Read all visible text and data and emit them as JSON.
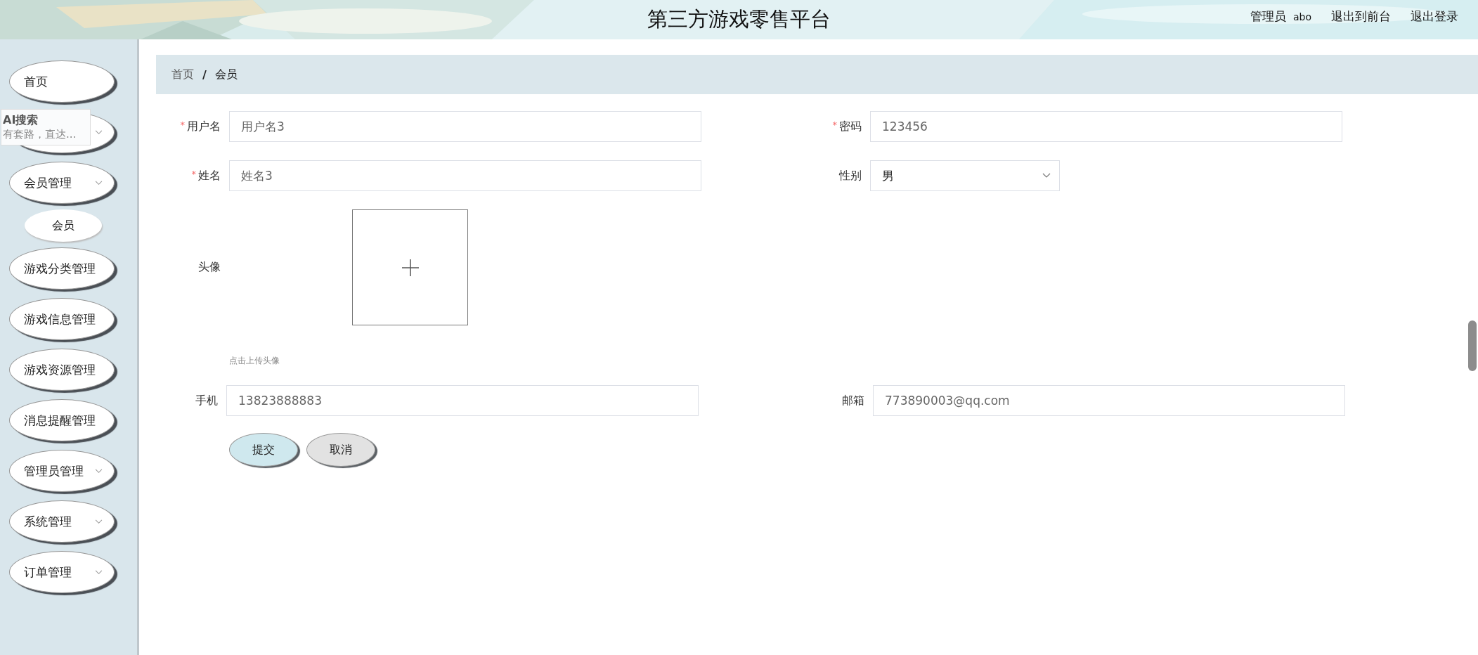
{
  "header": {
    "title": "第三方游戏零售平台",
    "user_role": "管理员",
    "user_name": "abo",
    "links": [
      "退出到前台",
      "退出登录"
    ]
  },
  "sidebar": {
    "items": [
      {
        "label": "首页",
        "expandable": false
      },
      {
        "expandable": true
      },
      {
        "label": "会员管理",
        "expandable": true,
        "children": [
          {
            "label": "会员"
          }
        ]
      },
      {
        "label": "游戏分类管理",
        "expandable": false
      },
      {
        "label": "游戏信息管理",
        "expandable": false
      },
      {
        "label": "游戏资源管理",
        "expandable": false
      },
      {
        "label": "消息提醒管理",
        "expandable": false
      },
      {
        "label": "管理员管理",
        "expandable": true
      },
      {
        "label": "系统管理",
        "expandable": true
      },
      {
        "label": "订单管理",
        "expandable": true
      }
    ]
  },
  "popup": {
    "title": "AI搜索",
    "text": "有套路，直达..."
  },
  "breadcrumb": {
    "separator": "/",
    "items": [
      "首页",
      "会员"
    ]
  },
  "form": {
    "fields": [
      {
        "kind": "text",
        "required_mark": "*",
        "label": "用户名",
        "value": "用户名3"
      },
      {
        "kind": "text",
        "required_mark": "*",
        "label": "密码",
        "value": "123456"
      },
      {
        "kind": "text",
        "required_mark": "*",
        "label": "姓名",
        "value": "姓名3"
      },
      {
        "kind": "select",
        "label": "性别",
        "value": "男"
      },
      {
        "kind": "upload",
        "label": "头像",
        "hint": "点击上传头像"
      },
      {
        "kind": "text",
        "label": "手机",
        "value": "13823888883"
      },
      {
        "kind": "text",
        "label": "邮箱",
        "value": "773890003@qq.com"
      }
    ],
    "buttons": [
      {
        "label": "提交",
        "kind": "primary"
      },
      {
        "label": "取消",
        "kind": "secondary"
      }
    ]
  }
}
